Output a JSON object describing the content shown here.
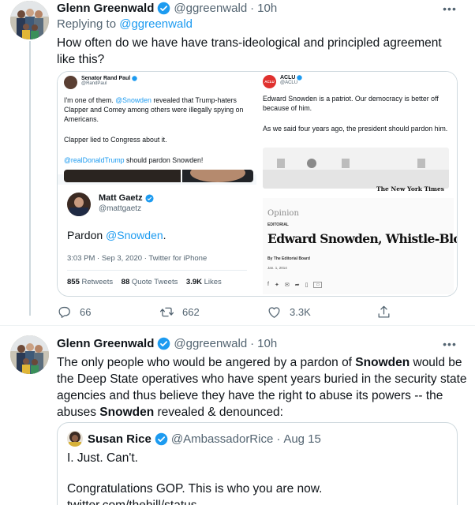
{
  "tweet1": {
    "name": "Glenn Greenwald",
    "handle": "@ggreenwald",
    "time": "10h",
    "replying_prefix": "Replying to ",
    "replying_handle": "@ggreenwald",
    "text": "How often do we have have trans-ideological and principled agreement like this?",
    "media": {
      "rand": {
        "name": "Senator Rand Paul",
        "handle": "@RandPaul",
        "text_a": "I'm one of them. ",
        "mention": "@Snowden",
        "text_b": " revealed that Trump-haters Clapper and Comey among others were illegally spying on Americans.",
        "line2": "Clapper lied to Congress about it.",
        "mention2": "@realDonaldTrump",
        "line3": " should pardon Snowden!"
      },
      "gaetz": {
        "name": "Matt Gaetz",
        "handle": "@mattgaetz",
        "text": "Pardon ",
        "mention": "@Snowden",
        "text_end": ".",
        "meta": "3:03 PM · Sep 3, 2020 · Twitter for iPhone",
        "retweets_count": "855",
        "retweets_label": "Retweets",
        "quotes_count": "88",
        "quotes_label": "Quote Tweets",
        "likes_count": "3.9K",
        "likes_label": "Likes"
      },
      "aclu": {
        "logo": "ACLU",
        "name": "ACLU",
        "handle": "@ACLU",
        "text1": "Edward Snowden is a patriot. Our democracy is better off because of him.",
        "text2": "As we said four years ago, the president should pardon him.",
        "nyt": "The New York Times",
        "section": "Opinion",
        "kicker": "EDITORIAL",
        "headline": "Edward Snowden, Whistle-Blower",
        "byline": "By The Editorial Board",
        "date": "Jan. 1, 2014"
      }
    },
    "actions": {
      "replies": "66",
      "retweets": "662",
      "likes": "3.3K"
    }
  },
  "tweet2": {
    "name": "Glenn Greenwald",
    "handle": "@ggreenwald",
    "time": "10h",
    "line1_a": "The only people who would be angered by a pardon of ",
    "line1_b": "Snowden",
    "line1_c": " would be",
    "line2": "the Deep State operatives who have spent years buried in the security state",
    "line3": "agencies and thus believe they have the right to abuse its powers -- the",
    "line4_a": "abuses ",
    "line4_b": "Snowden",
    "line4_c": " revealed & denounced:",
    "quote": {
      "name": "Susan Rice",
      "handle": "@AmbassadorRice",
      "time": "Aug 15",
      "text1": "I. Just. Can't.",
      "text2": "Congratulations GOP. This is who you are now.",
      "text3": "twitter.com/thehill/status..."
    }
  },
  "colors": {
    "accent": "#1d9bf0",
    "secondary_text": "#536471",
    "border": "#cfd9de"
  }
}
